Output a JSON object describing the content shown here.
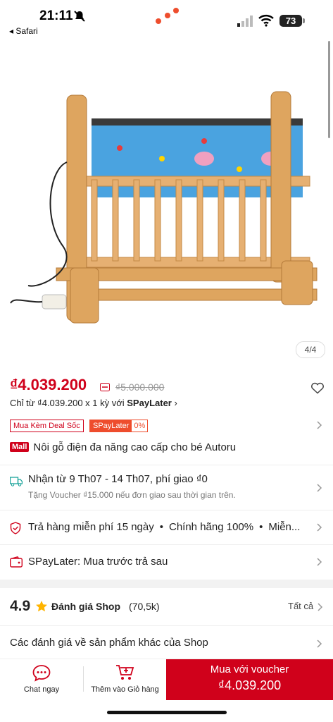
{
  "status": {
    "time": "21:11",
    "back_label": "◂ Safari",
    "battery": "73"
  },
  "gallery": {
    "counter": "4/4"
  },
  "price": {
    "current": "₫4.039.200",
    "original": "₫5.000.000",
    "installment_prefix": "Chỉ từ ₫4.039.200 x 1 kỳ với ",
    "installment_brand": "SPayLater"
  },
  "promos": {
    "deal": "Mua Kèm Deal Sốc",
    "spay_label": "SPayLater",
    "spay_rate": "0%"
  },
  "product": {
    "mall_badge": "Mall",
    "title": "Nôi gỗ điện đa năng cao cấp cho bé Autoru"
  },
  "shipping": {
    "main": "Nhận từ 9 Th07 - 14 Th07, phí giao ₫0",
    "sub": "Tặng Voucher ₫15.000 nếu đơn giao sau thời gian trên."
  },
  "guarantees": {
    "returns": "Trả hàng miễn phí 15 ngày",
    "authentic": "Chính hãng 100%",
    "more": "Miễn..."
  },
  "spaylater": {
    "text": "SPayLater: Mua trước trả sau"
  },
  "rating": {
    "score": "4.9",
    "label": "Đánh giá Shop",
    "count": "(70,5k)",
    "see_all": "Tất cả"
  },
  "other_reviews": "Các đánh giá về sản phẩm khác của Shop",
  "bottom": {
    "chat": "Chat ngay",
    "add_cart": "Thêm vào Giỏ hàng",
    "buy_label": "Mua với voucher",
    "buy_price": "₫4.039.200"
  },
  "colors": {
    "brand_red": "#d0011b",
    "spay_orange": "#ee4d2d"
  }
}
